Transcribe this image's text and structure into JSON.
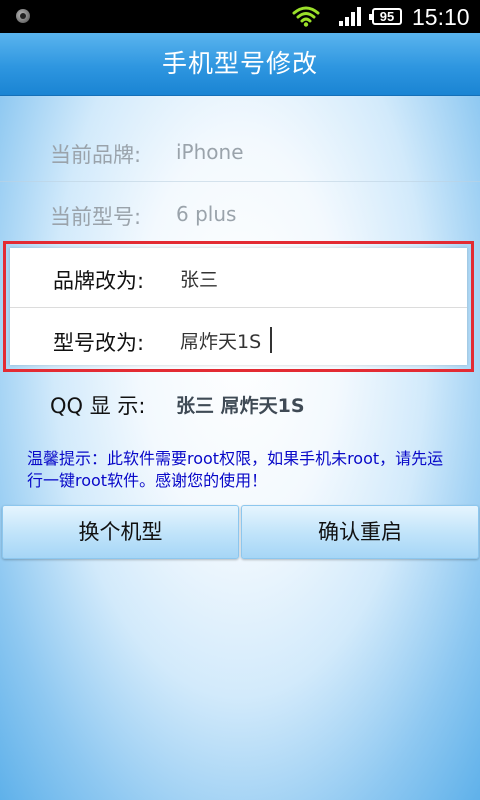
{
  "status_bar": {
    "battery": "95",
    "time": "15:10"
  },
  "header": {
    "title": "手机型号修改"
  },
  "current": {
    "brand_label": "当前品牌:",
    "brand_value": "iPhone",
    "model_label": "当前型号:",
    "model_value": "6 plus"
  },
  "edit": {
    "brand_label": "品牌改为:",
    "brand_value": "张三",
    "model_label": "型号改为:",
    "model_value": "屌炸天1S"
  },
  "qq": {
    "label": "QQ 显 示:",
    "value": "张三 屌炸天1S"
  },
  "tip": "温馨提示：此软件需要root权限，如果手机未root，请先运行一键root软件。感谢您的使用！",
  "buttons": {
    "change_model": "换个机型",
    "confirm_restart": "确认重启"
  },
  "colors": {
    "title_bar": "#2e96e0",
    "highlight_border": "#e32b33",
    "tip_text": "#0808c8"
  },
  "icons": [
    "notification-dot-icon",
    "wifi-icon",
    "signal-icon",
    "battery-icon"
  ]
}
